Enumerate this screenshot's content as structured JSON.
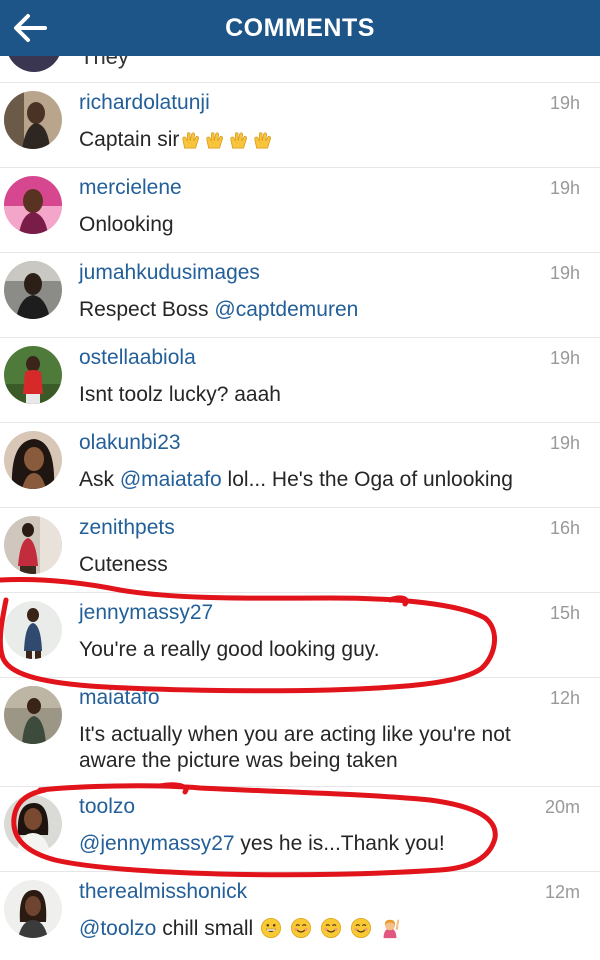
{
  "header": {
    "title": "COMMENTS",
    "back_icon": "arrow-left-icon",
    "color": "#1d5589"
  },
  "partial_comment": {
    "text": "They"
  },
  "comments": [
    {
      "username": "richardolatunji",
      "time": "19h",
      "text": "Captain sir",
      "emoji": [
        "raising-hands",
        "raising-hands",
        "raising-hands",
        "raising-hands"
      ]
    },
    {
      "username": "mercielene",
      "time": "19h",
      "text": "Onlooking"
    },
    {
      "username": "jumahkudusimages",
      "time": "19h",
      "text": "Respect Boss ",
      "mention": "@captdemuren"
    },
    {
      "username": "ostellaabiola",
      "time": "19h",
      "text": "Isnt toolz lucky? aaah"
    },
    {
      "username": "olakunbi23",
      "time": "19h",
      "text_before": "Ask ",
      "mention": "@maiatafo",
      "text_after": " lol... He's the Oga of unlooking"
    },
    {
      "username": "zenithpets",
      "time": "16h",
      "text": "Cuteness"
    },
    {
      "username": "jennymassy27",
      "time": "15h",
      "text": "You're a really good looking guy."
    },
    {
      "username": "maiatafo",
      "time": "12h",
      "text": "It's actually when you are acting like you're not aware the picture was being taken"
    },
    {
      "username": "toolzo",
      "time": "20m",
      "mention": "@jennymassy27",
      "text": " yes he is...Thank you!"
    },
    {
      "username": "therealmisshonick",
      "time": "12m",
      "mention": "@toolzo",
      "text": " chill small",
      "emoji": [
        "grinning-face",
        "smiling-face",
        "smiling-face",
        "smiling-face",
        "woman-raising-hand"
      ]
    }
  ],
  "colors": {
    "username": "#235f99",
    "timestamp": "#999999",
    "annotation": "#e0141a"
  }
}
